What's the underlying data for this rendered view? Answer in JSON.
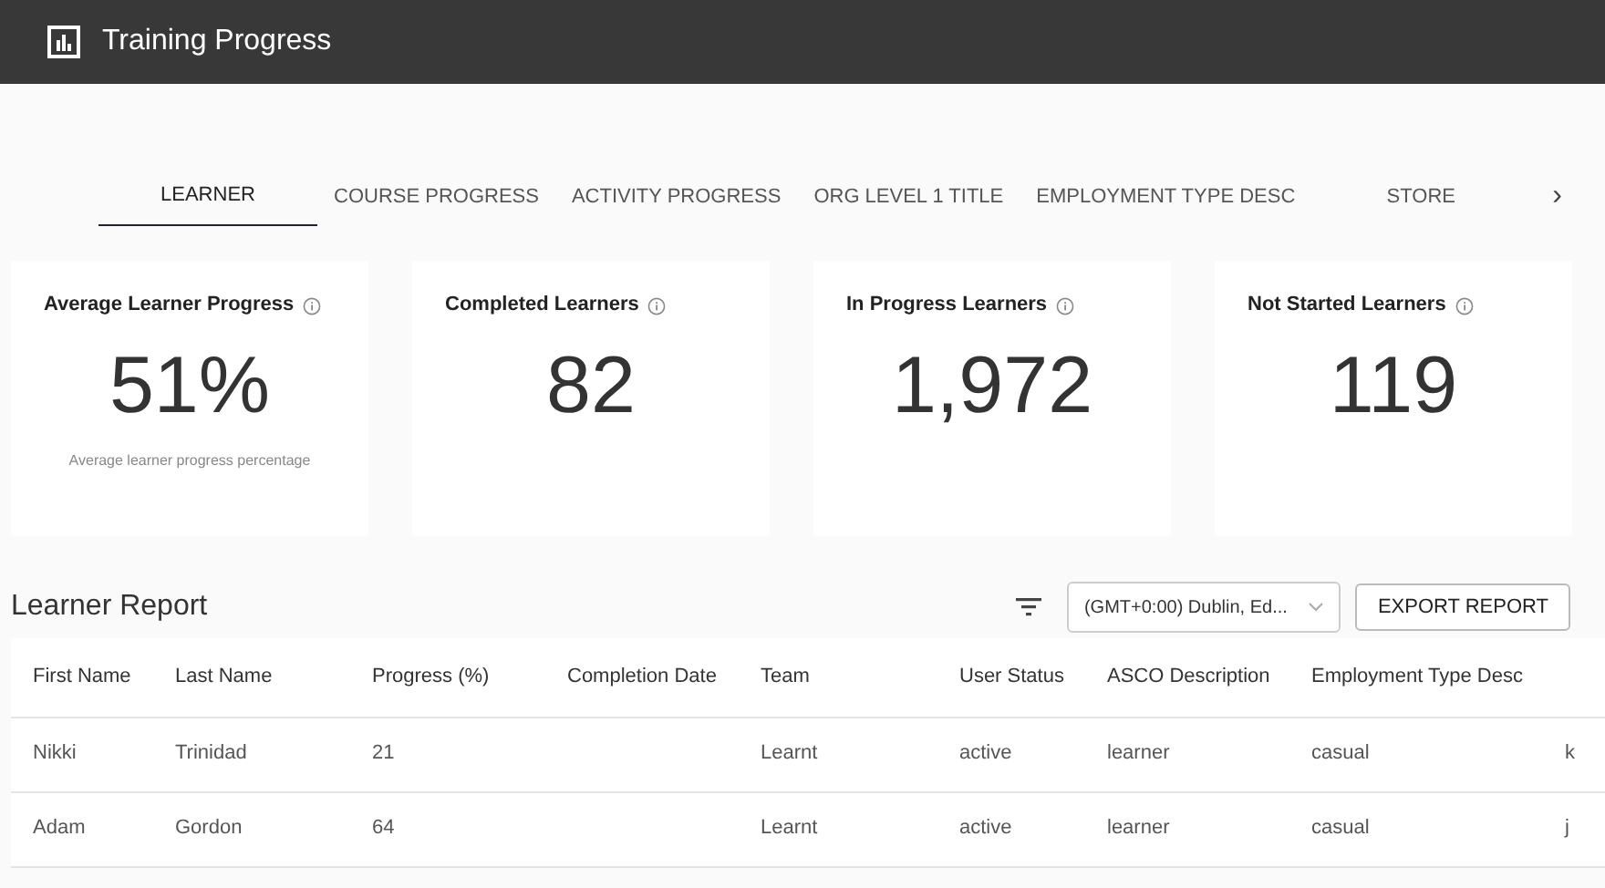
{
  "window": {
    "title": "Training Progress"
  },
  "tabs": [
    {
      "label": "LEARNER",
      "selected": true
    },
    {
      "label": "COURSE PROGRESS",
      "selected": false
    },
    {
      "label": "ACTIVITY PROGRESS",
      "selected": false
    },
    {
      "label": "ORG LEVEL 1 TITLE",
      "selected": false
    },
    {
      "label": "EMPLOYMENT TYPE DESC",
      "selected": false
    },
    {
      "label": "STORE",
      "selected": false
    }
  ],
  "tabs_next": "›",
  "stats": [
    {
      "title": "Average Learner Progress",
      "value": "51%",
      "caption": "Average learner progress percentage"
    },
    {
      "title": "Completed Learners",
      "value": "82"
    },
    {
      "title": "In Progress Learners",
      "value": "1,972"
    },
    {
      "title": "Not Started Learners",
      "value": "119"
    }
  ],
  "report": {
    "title": "Learner Report",
    "timezone": "(GMT+0:00) Dublin, Ed...",
    "export_button": "EXPORT REPORT"
  },
  "table": {
    "columns": [
      "First Name",
      "Last Name",
      "Progress (%)",
      "Completion Date",
      "Team",
      "User Status",
      "ASCO Description",
      "Employment Type Desc"
    ],
    "rows": [
      [
        "Nikki",
        "Trinidad",
        "21",
        "",
        "Learnt",
        "active",
        "learner",
        "casual",
        "k"
      ],
      [
        "Adam",
        "Gordon",
        "64",
        "",
        "Learnt",
        "active",
        "learner",
        "casual",
        "j"
      ]
    ]
  }
}
